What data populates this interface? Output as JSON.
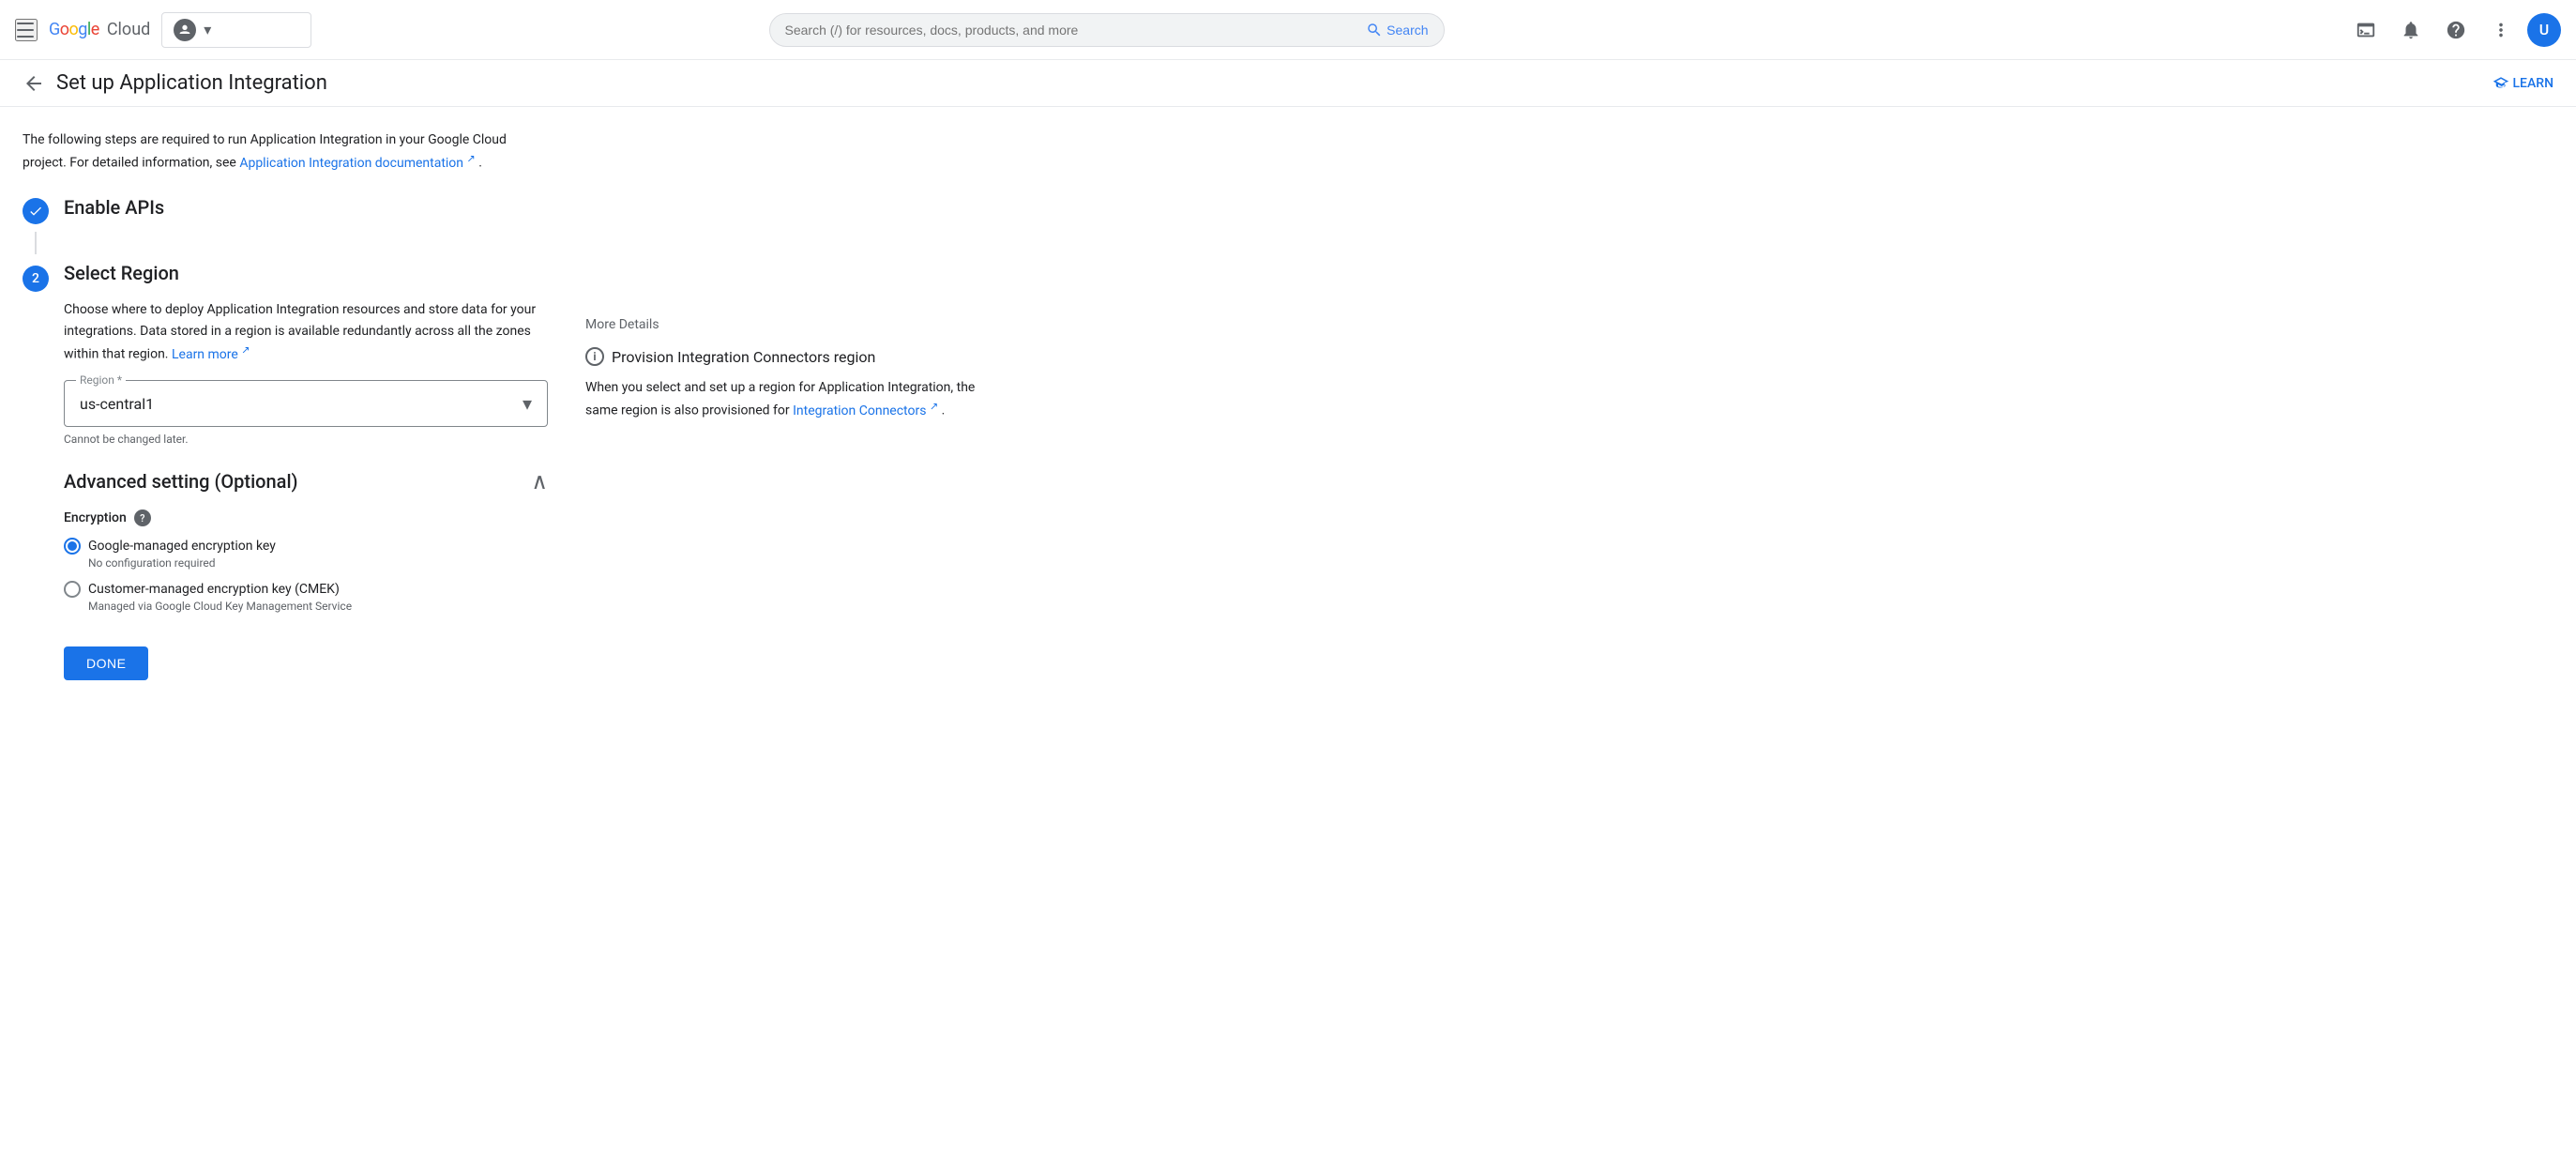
{
  "nav": {
    "hamburger_label": "Menu",
    "logo_text": "Google Cloud",
    "project_selector_label": "Project selector",
    "search_placeholder": "Search (/) for resources, docs, products, and more",
    "search_button": "Search",
    "terminal_icon": "terminal",
    "notifications_icon": "notifications",
    "help_icon": "help",
    "more_icon": "more-vert",
    "avatar_initial": "U"
  },
  "sub_header": {
    "back_label": "Back",
    "title": "Set up Application Integration",
    "learn_label": "LEARN"
  },
  "page": {
    "intro": "The following steps are required to run Application Integration in your Google Cloud project. For detailed information, see",
    "intro_link": "Application Integration documentation",
    "intro_period": "."
  },
  "steps": {
    "step1": {
      "label": "Enable APIs"
    },
    "step2": {
      "number": "2",
      "label": "Select Region",
      "description": "Choose where to deploy Application Integration resources and store data for your integrations. Data stored in a region is available redundantly across all the zones within that region.",
      "learn_more": "Learn more",
      "region_field_label": "Region *",
      "region_value": "us-central1",
      "region_note": "Cannot be changed later.",
      "advanced": {
        "title": "Advanced setting (Optional)",
        "encryption": {
          "label": "Encryption",
          "help": "?",
          "option1_label": "Google-managed encryption key",
          "option1_sub": "No configuration required",
          "option2_label": "Customer-managed encryption key (CMEK)",
          "option2_sub": "Managed via Google Cloud Key Management Service"
        }
      },
      "done_button": "DONE"
    }
  },
  "right_panel": {
    "more_details": "More Details",
    "provision_title": "Provision Integration Connectors region",
    "provision_desc": "When you select and set up a region for Application Integration, the same region is also provisioned for",
    "provision_link": "Integration Connectors",
    "provision_period": "."
  }
}
